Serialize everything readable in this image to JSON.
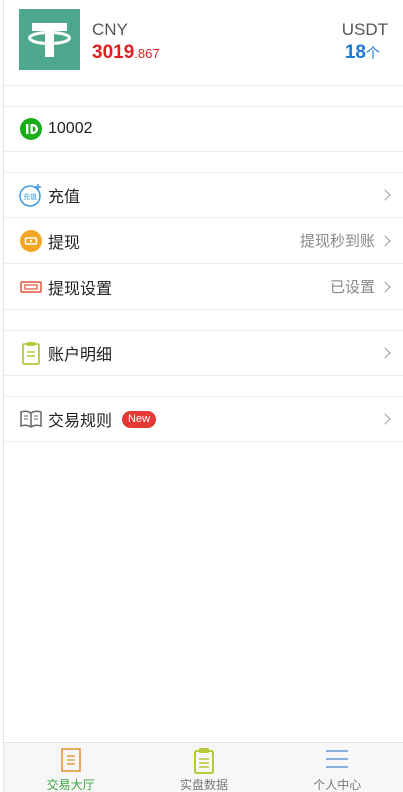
{
  "wallet": {
    "cny_label": "CNY",
    "cny_int": "3019",
    "cny_dec": ".867",
    "usdt_label": "USDT",
    "usdt_amount": "18",
    "usdt_unit": "个"
  },
  "id_row": {
    "value": "10002"
  },
  "menu": {
    "recharge": {
      "label": "充值",
      "icon_text": "充值"
    },
    "withdraw": {
      "label": "提现",
      "value": "提现秒到账"
    },
    "withdraw_settings": {
      "label": "提现设置",
      "value": "已设置"
    },
    "account_details": {
      "label": "账户明细"
    },
    "trade_rules": {
      "label": "交易规则",
      "badge": "New"
    }
  },
  "tabbar": {
    "tabs": [
      {
        "label": "交易大厅",
        "icon": "document-list-icon",
        "active": true
      },
      {
        "label": "实盘数据",
        "icon": "clipboard-icon",
        "active": false
      },
      {
        "label": "个人中心",
        "icon": "menu-lines-icon",
        "active": false
      }
    ]
  },
  "colors": {
    "brand_green": "#4ea88d",
    "cny_red": "#e0201f",
    "usdt_blue": "#1a7ad6",
    "badge_red": "#e53935",
    "active_tab_green": "#3aa642"
  }
}
